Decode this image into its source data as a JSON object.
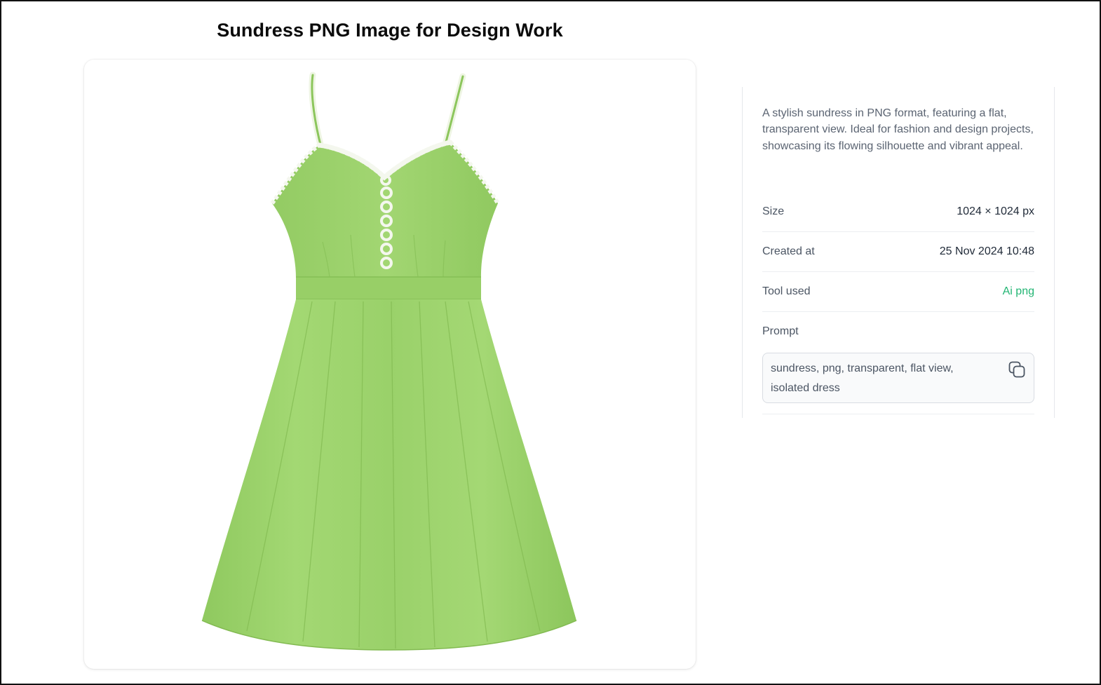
{
  "page": {
    "title": "Sundress PNG Image for Design Work"
  },
  "image": {
    "subject": "green-sundress",
    "dress_color": "#9fd46f",
    "trim_color": "#f4f7ee"
  },
  "details": {
    "description": "A stylish sundress in PNG format, featuring a flat, transparent view. Ideal for fashion and design projects, showcasing its flowing silhouette and vibrant appeal.",
    "rows": [
      {
        "label": "Size",
        "value": "1024 × 1024 px"
      },
      {
        "label": "Created at",
        "value": "25 Nov 2024 10:48"
      },
      {
        "label": "Tool used",
        "value": "Ai png"
      }
    ],
    "prompt_label": "Prompt",
    "prompt_text": "sundress, png, transparent, flat view, isolated dress",
    "copy_icon": "copy-icon",
    "accent_color": "#22b573"
  }
}
